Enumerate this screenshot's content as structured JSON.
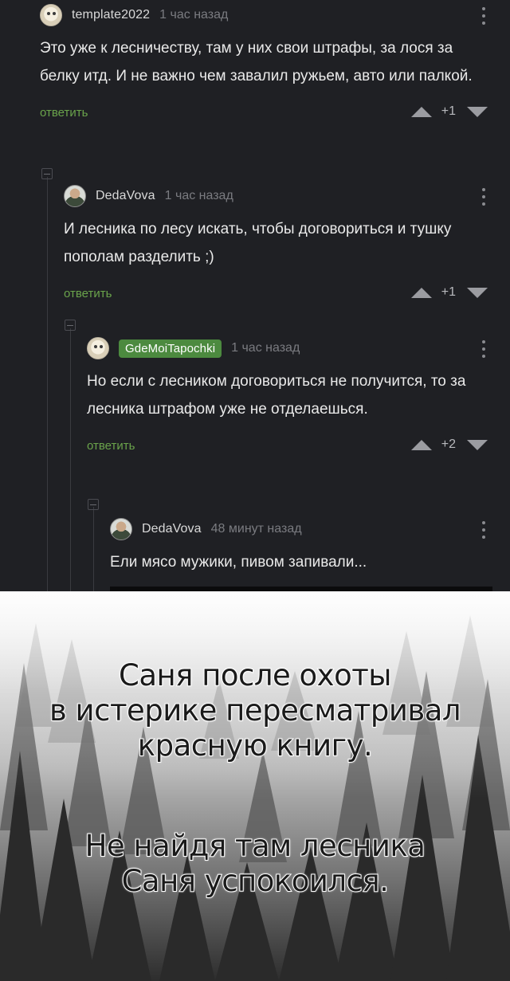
{
  "comments": [
    {
      "username": "template2022",
      "time": "1 час назад",
      "text": "Это уже к лесничеству, там у них свои штрафы, за лося за белку итд. И не важно чем завалил ружьем, авто или палкой.",
      "reply_label": "ответить",
      "score": "+1"
    },
    {
      "username": "DedaVova",
      "time": "1 час назад",
      "text": "И лесника по лесу искать, чтобы договориться и тушку пополам разделить ;)",
      "reply_label": "ответить",
      "score": "+1"
    },
    {
      "username": "GdeMoiTapochki",
      "time": "1 час назад",
      "text": "Но если с лесником договориться не получится, то за лесника штрафом уже не отделаешься.",
      "reply_label": "ответить",
      "score": "+2"
    },
    {
      "username": "DedaVova",
      "time": "48 минут назад",
      "text": "Ели мясо мужики, пивом запивали..."
    }
  ],
  "meme": {
    "caption_top": [
      "Саня после охоты",
      "в истерике пересматривал",
      "красную книгу."
    ],
    "caption_bottom": [
      "Не найдя там лесника",
      "Саня успокоился."
    ]
  },
  "icons": {
    "avatar": "user-avatar-icon",
    "kebab": "more-vertical-icon",
    "upvote": "triangle-up-icon",
    "downvote": "triangle-down-icon",
    "collapse": "collapse-thread-icon"
  },
  "colors": {
    "background": "#1f2024",
    "reply_link": "#6aa34b",
    "badge": "#4c8a3f"
  }
}
